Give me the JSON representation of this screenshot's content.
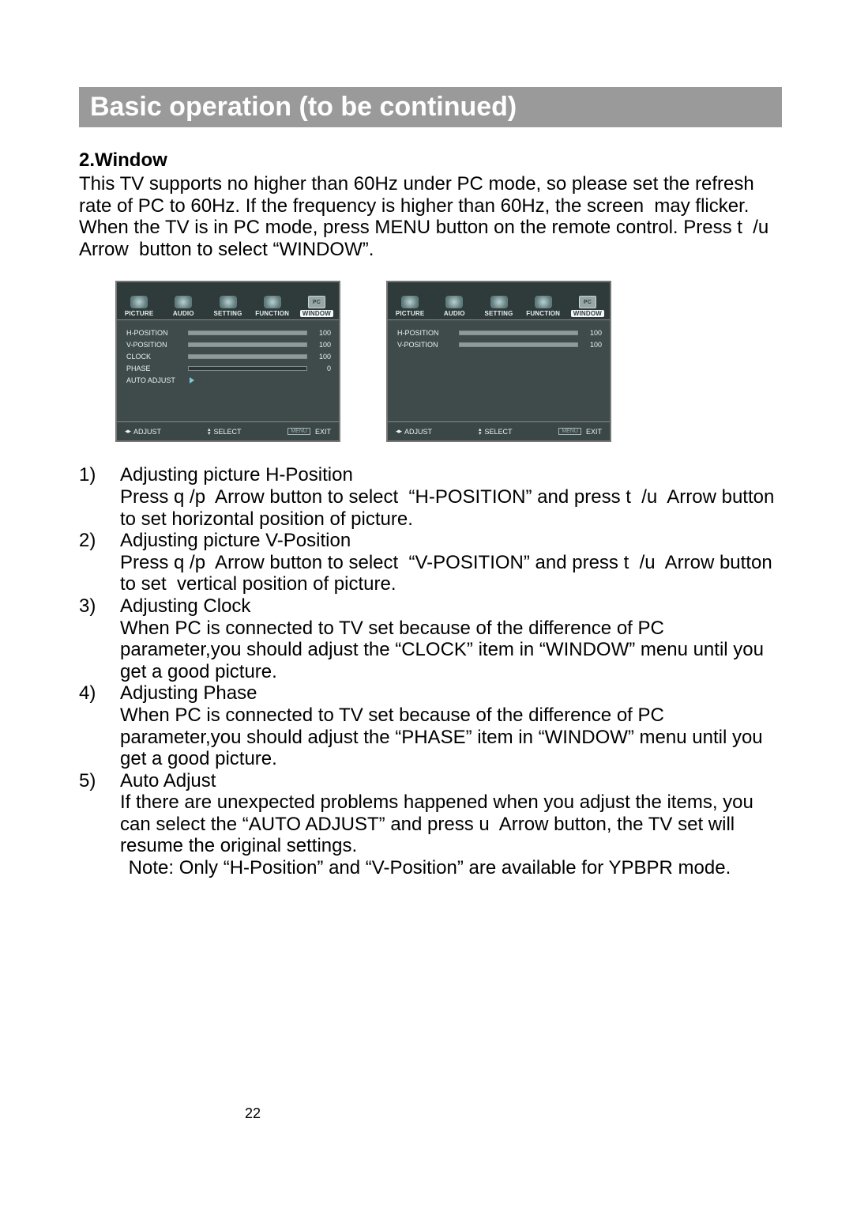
{
  "header": "Basic operation (to be continued)",
  "subtitle": "2.Window",
  "intro": "This TV supports no higher than 60Hz under PC mode, so please set the refresh rate of PC to 60Hz. If the frequency is higher than 60Hz, the screen  may flicker. When the TV is in PC mode, press MENU button on the remote control. Press t  /u  Arrow  button to select “WINDOW”.",
  "osd_tabs": [
    "PICTURE",
    "AUDIO",
    "SETTING",
    "FUNCTION",
    "WINDOW"
  ],
  "pc_label": "PC",
  "osd_left": {
    "rows": [
      {
        "label": "H-POSITION",
        "value": "100",
        "bar": true
      },
      {
        "label": "V-POSITION",
        "value": "100",
        "bar": true
      },
      {
        "label": "CLOCK",
        "value": "100",
        "bar": true
      },
      {
        "label": "PHASE",
        "value": "0",
        "bar": true
      },
      {
        "label": "AUTO ADJUST",
        "value": "",
        "bar": false
      }
    ]
  },
  "osd_right": {
    "rows": [
      {
        "label": "H-POSITION",
        "value": "100",
        "bar": true
      },
      {
        "label": "V-POSITION",
        "value": "100",
        "bar": true
      }
    ]
  },
  "footer_labels": {
    "adjust": "ADJUST",
    "select": "SELECT",
    "menu": "MENU",
    "exit": "EXIT"
  },
  "steps": [
    {
      "n": "1)",
      "title": "Adjusting picture H-Position",
      "text": "Press q /p  Arrow button to select  “H-POSITION” and press t  /u  Arrow button to set horizontal position of picture."
    },
    {
      "n": "2)",
      "title": "Adjusting picture V-Position",
      "text": "Press q /p  Arrow button to select  “V-POSITION” and press t  /u  Arrow button to set  vertical position of picture."
    },
    {
      "n": "3)",
      "title": "Adjusting Clock",
      "text": "When PC is connected to TV set because of the difference of PC parameter,you should adjust the “CLOCK” item in “WINDOW” menu until you get a good picture."
    },
    {
      "n": "4)",
      "title": "Adjusting Phase",
      "text": "When PC is connected to TV set because of the difference of PC parameter,you should adjust the “PHASE” item in “WINDOW” menu until you get a good picture."
    },
    {
      "n": "5)",
      "title": "Auto Adjust",
      "text": "If there are unexpected problems happened when you adjust the items, you can select the “AUTO ADJUST” and press u  Arrow button, the TV set will resume the original settings."
    }
  ],
  "note": " Note: Only “H-Position” and “V-Position” are available for YPBPR mode.",
  "page_number": "22"
}
